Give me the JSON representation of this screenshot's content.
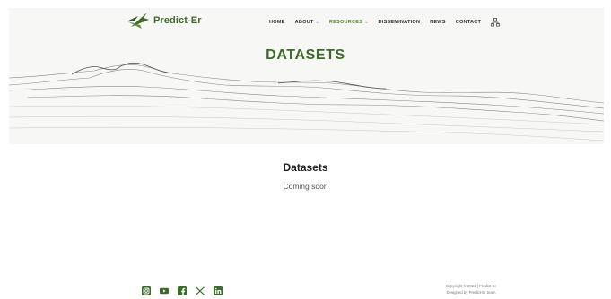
{
  "header": {
    "logo_text": "Predict-Er"
  },
  "nav": {
    "home": "HOME",
    "about": "ABOUT",
    "resources": "RESOURCES",
    "dissemination": "DISSEMINATION",
    "news": "NEWS",
    "contact": "CONTACT",
    "dropdown_glyph": "⌄"
  },
  "hero": {
    "title": "DATASETS"
  },
  "content": {
    "title": "Datasets",
    "subtitle": "Coming soon"
  },
  "footer": {
    "social": [
      "instagram-icon",
      "youtube-icon",
      "facebook-icon",
      "x-icon",
      "linkedin-icon"
    ],
    "copyright": "Copyright © 2024 | Predict-Er",
    "designed_by": "Designed by Predict-Er team"
  },
  "colors": {
    "brand_green": "#3e6b2b",
    "accent_green": "#5c8a3a",
    "hero_bg": "#f7f7f5"
  }
}
